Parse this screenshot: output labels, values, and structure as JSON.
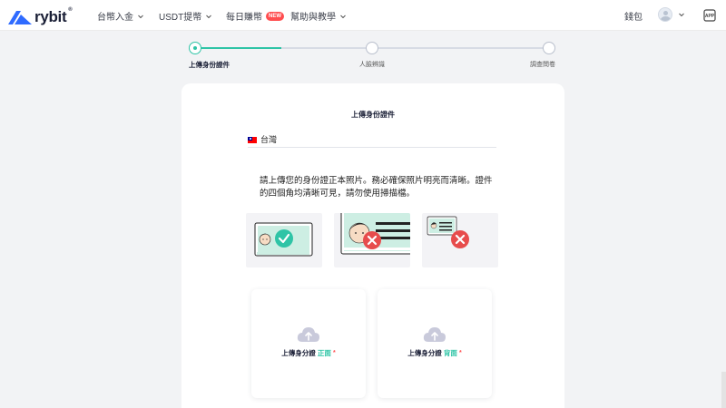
{
  "header": {
    "logo_text": "rybit",
    "logo_reg": "®",
    "nav": [
      {
        "label": "台幣入金",
        "has_dropdown": true
      },
      {
        "label": "USDT提幣",
        "has_dropdown": true
      },
      {
        "label": "每日賺幣",
        "badge": "NEW"
      },
      {
        "label": "幫助與教學",
        "has_dropdown": true
      }
    ],
    "wallet_label": "錢包",
    "icons": [
      "chevron-down-icon",
      "user-avatar-icon",
      "app-download-icon"
    ]
  },
  "stepper": {
    "steps": [
      {
        "label": "上傳身份證件",
        "active": true
      },
      {
        "label": "人臉辨識",
        "active": false
      },
      {
        "label": "調查問卷",
        "active": false
      }
    ],
    "progress": 0.25
  },
  "card": {
    "title": "上傳身份證件",
    "country": "台灣",
    "country_flag": "taiwan-flag-icon",
    "instructions": "請上傳您的身份證正本照片。務必確保照片明亮而清晰。證件的四個角均清晰可見，請勿使用掃描檔。",
    "examples": [
      {
        "name": "correct-example",
        "status": "check-icon"
      },
      {
        "name": "cropped-example",
        "status": "cross-icon"
      },
      {
        "name": "too-far-example",
        "status": "cross-icon"
      }
    ],
    "upload_front": {
      "prefix": "上傳身分證",
      "side": "正面",
      "required": "*"
    },
    "upload_back": {
      "prefix": "上傳身分證",
      "side": "背面",
      "required": "*"
    }
  },
  "colors": {
    "accent": "#2ec4a6",
    "error": "#e74c4c",
    "brand": "#1a1f36",
    "logo_blue": "#2f6bff"
  }
}
